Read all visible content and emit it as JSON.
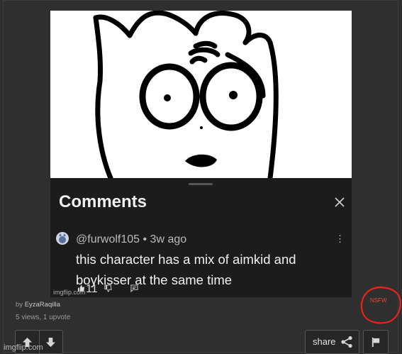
{
  "meme": {
    "comments_title": "Comments",
    "comment_meta": "@furwolf105 • 3w ago",
    "comment_text": "this character has a mix of aimkid and boykisser at the same time",
    "like_count": "11",
    "watermark_inner": "imgflip.com"
  },
  "post": {
    "by_prefix": "by",
    "author": "EyzaRaqilla",
    "stats": "5 views, 1 upvote",
    "tag": "NSFW",
    "tag_color": "#e8473a",
    "share_label": "share",
    "watermark": "imgflip.com"
  },
  "icons": {
    "upvote": "arrow-up-icon",
    "downvote": "arrow-down-icon",
    "share": "share-icon",
    "flag": "flag-icon",
    "close": "close-icon"
  }
}
